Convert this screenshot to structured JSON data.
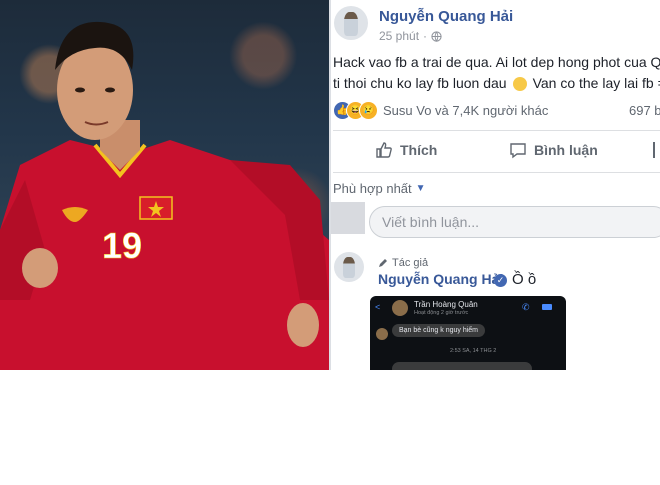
{
  "post": {
    "author": "Nguyễn Quang Hải",
    "time": "25 phút",
    "privacy_icon": "globe-icon",
    "text_line1": "Hack vao fb a trai de qua. Ai lot dep hong phot cua Q",
    "text_line2": "ti thoi chu ko lay fb luon dau",
    "text_line2_end": "Van co the lay lai fb =",
    "reactions_text": "Susu Vo và 7,4K người khác",
    "comments_count": "697 b",
    "reaction_icons": [
      "like-icon",
      "haha-icon",
      "sad-icon"
    ]
  },
  "actions": {
    "like": "Thích",
    "comment": "Bình luận"
  },
  "comments": {
    "sort_label": "Phù hợp nhất",
    "input_placeholder": "Viết bình luận...",
    "author_tag": "Tác giả",
    "reply_author": "Nguyễn Quang Hải",
    "reply_text": "Ồ ồ"
  },
  "messenger": {
    "contact_name": "Trần Hoàng Quân",
    "status": "Hoạt động 2 giờ trước",
    "bubble": "Bạn bè cũng k nguy hiểm",
    "timestamp": "2:53 SA, 14 THG 2"
  },
  "colors": {
    "fb_blue": "#4267b2",
    "link_blue": "#385898",
    "jersey_red": "#c8102e"
  }
}
